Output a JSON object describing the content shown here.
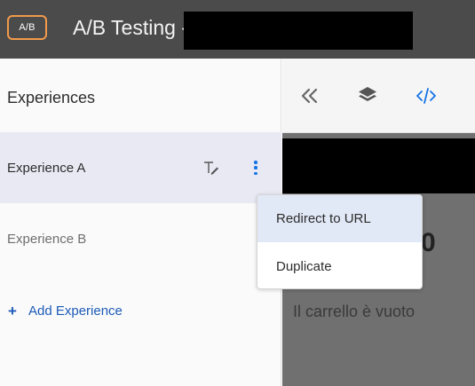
{
  "header": {
    "badge": "A/B",
    "title": "A/B Testing -"
  },
  "sidebar": {
    "title": "Experiences",
    "experiences": [
      {
        "label": "Experience A",
        "selected": true
      },
      {
        "label": "Experience B",
        "selected": false
      }
    ],
    "add_label": "Add Experience",
    "add_icon": "+"
  },
  "toolbar": {
    "icons": [
      "double-chevron-left-icon",
      "layers-icon",
      "code-icon"
    ]
  },
  "context_menu": {
    "items": [
      "Redirect to URL",
      "Duplicate"
    ]
  },
  "preview": {
    "fragment_text": "0",
    "cart_text": "Il carrello è vuoto"
  },
  "colors": {
    "header_bg": "#4b4b4b",
    "badge_border": "#f29a4b",
    "accent_blue": "#1473e6",
    "selected_row": "#e8e9f3",
    "menu_highlight": "#e2e9f6"
  }
}
